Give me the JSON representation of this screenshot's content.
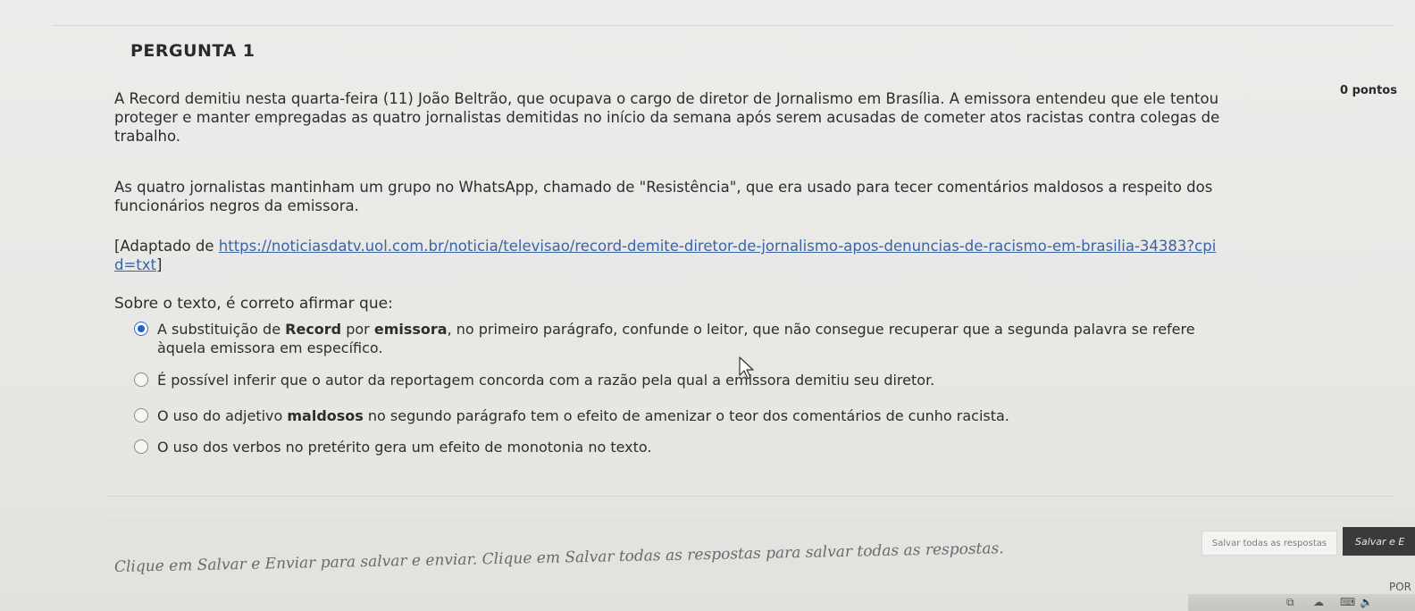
{
  "question": {
    "title": "PERGUNTA 1",
    "points": "0 pontos",
    "paragraph1": "A Record demitiu nesta quarta-feira (11) João Beltrão, que ocupava o cargo de diretor de Jornalismo em Brasília. A emissora entendeu que ele tentou proteger e manter empregadas as quatro jornalistas demitidas no início da semana após serem acusadas de cometer atos racistas contra colegas de trabalho.",
    "paragraph2": "As quatro jornalistas mantinham um grupo no WhatsApp, chamado de \"Resistência\", que era usado para tecer comentários maldosos a respeito dos funcionários negros da emissora.",
    "source_prefix": "[Adaptado de ",
    "source_link": "https://noticiasdatv.uol.com.br/noticia/televisao/record-demite-diretor-de-jornalismo-apos-denuncias-de-racismo-em-brasilia-34383?cpid=txt",
    "source_suffix": "]",
    "prompt": "Sobre o texto, é correto afirmar que:"
  },
  "options": [
    {
      "selected": true,
      "part1": "A substituição de ",
      "bold1": "Record",
      "part2": " por ",
      "bold2": "emissora",
      "part3": ", no primeiro parágrafo, confunde o leitor, que não consegue recuperar que a segunda palavra se refere àquela emissora em específico."
    },
    {
      "selected": false,
      "text": "É possível inferir que o autor da reportagem concorda com a razão pela qual a emissora demitiu seu diretor."
    },
    {
      "selected": false,
      "part1": "O uso do adjetivo ",
      "bold1": "maldosos",
      "part2": " no segundo parágrafo tem o efeito de amenizar o teor dos comentários de cunho racista."
    },
    {
      "selected": false,
      "text": "O uso dos verbos no pretérito gera um efeito de monotonia no texto."
    }
  ],
  "footer": {
    "instructions": "Clique em Salvar e Enviar para salvar e enviar. Clique em Salvar todas as respostas para salvar todas as respostas.",
    "save_all_label": "Salvar todas as respostas",
    "save_submit_label": "Salvar e E"
  },
  "taskbar": {
    "lang": "POR"
  },
  "colors": {
    "link": "#3b64a8",
    "radio_selected": "#1f62c9",
    "submit_bg": "#3a3a3a"
  }
}
